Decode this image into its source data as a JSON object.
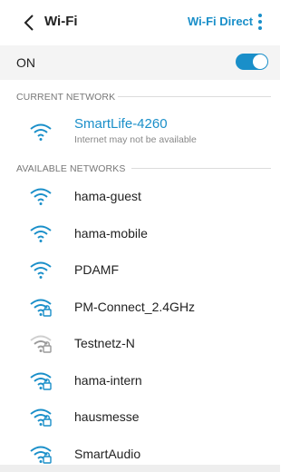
{
  "header": {
    "title": "Wi-Fi",
    "wifi_direct": "Wi-Fi Direct",
    "back_icon": "chevron-left-icon",
    "more_icon": "more-vert-icon"
  },
  "master_switch": {
    "label": "ON",
    "state": "on"
  },
  "current_network": {
    "section_label": "CURRENT NETWORK",
    "name": "SmartLife-4260",
    "status": "Internet may not be available",
    "secured": false
  },
  "available_networks": {
    "section_label": "AVAILABLE NETWORKS",
    "items": [
      {
        "name": "hama-guest",
        "secured": false,
        "strength": "full"
      },
      {
        "name": "hama-mobile",
        "secured": false,
        "strength": "full"
      },
      {
        "name": "PDAMF",
        "secured": false,
        "strength": "full"
      },
      {
        "name": "PM-Connect_2.4GHz",
        "secured": true,
        "strength": "full"
      },
      {
        "name": "Testnetz-N",
        "secured": true,
        "strength": "weak"
      },
      {
        "name": "hama-intern",
        "secured": true,
        "strength": "full"
      },
      {
        "name": "hausmesse",
        "secured": true,
        "strength": "full"
      },
      {
        "name": "SmartAudio",
        "secured": true,
        "strength": "full"
      }
    ]
  },
  "colors": {
    "accent": "#1a8fc9",
    "weak_signal": "#9a9a9a"
  }
}
